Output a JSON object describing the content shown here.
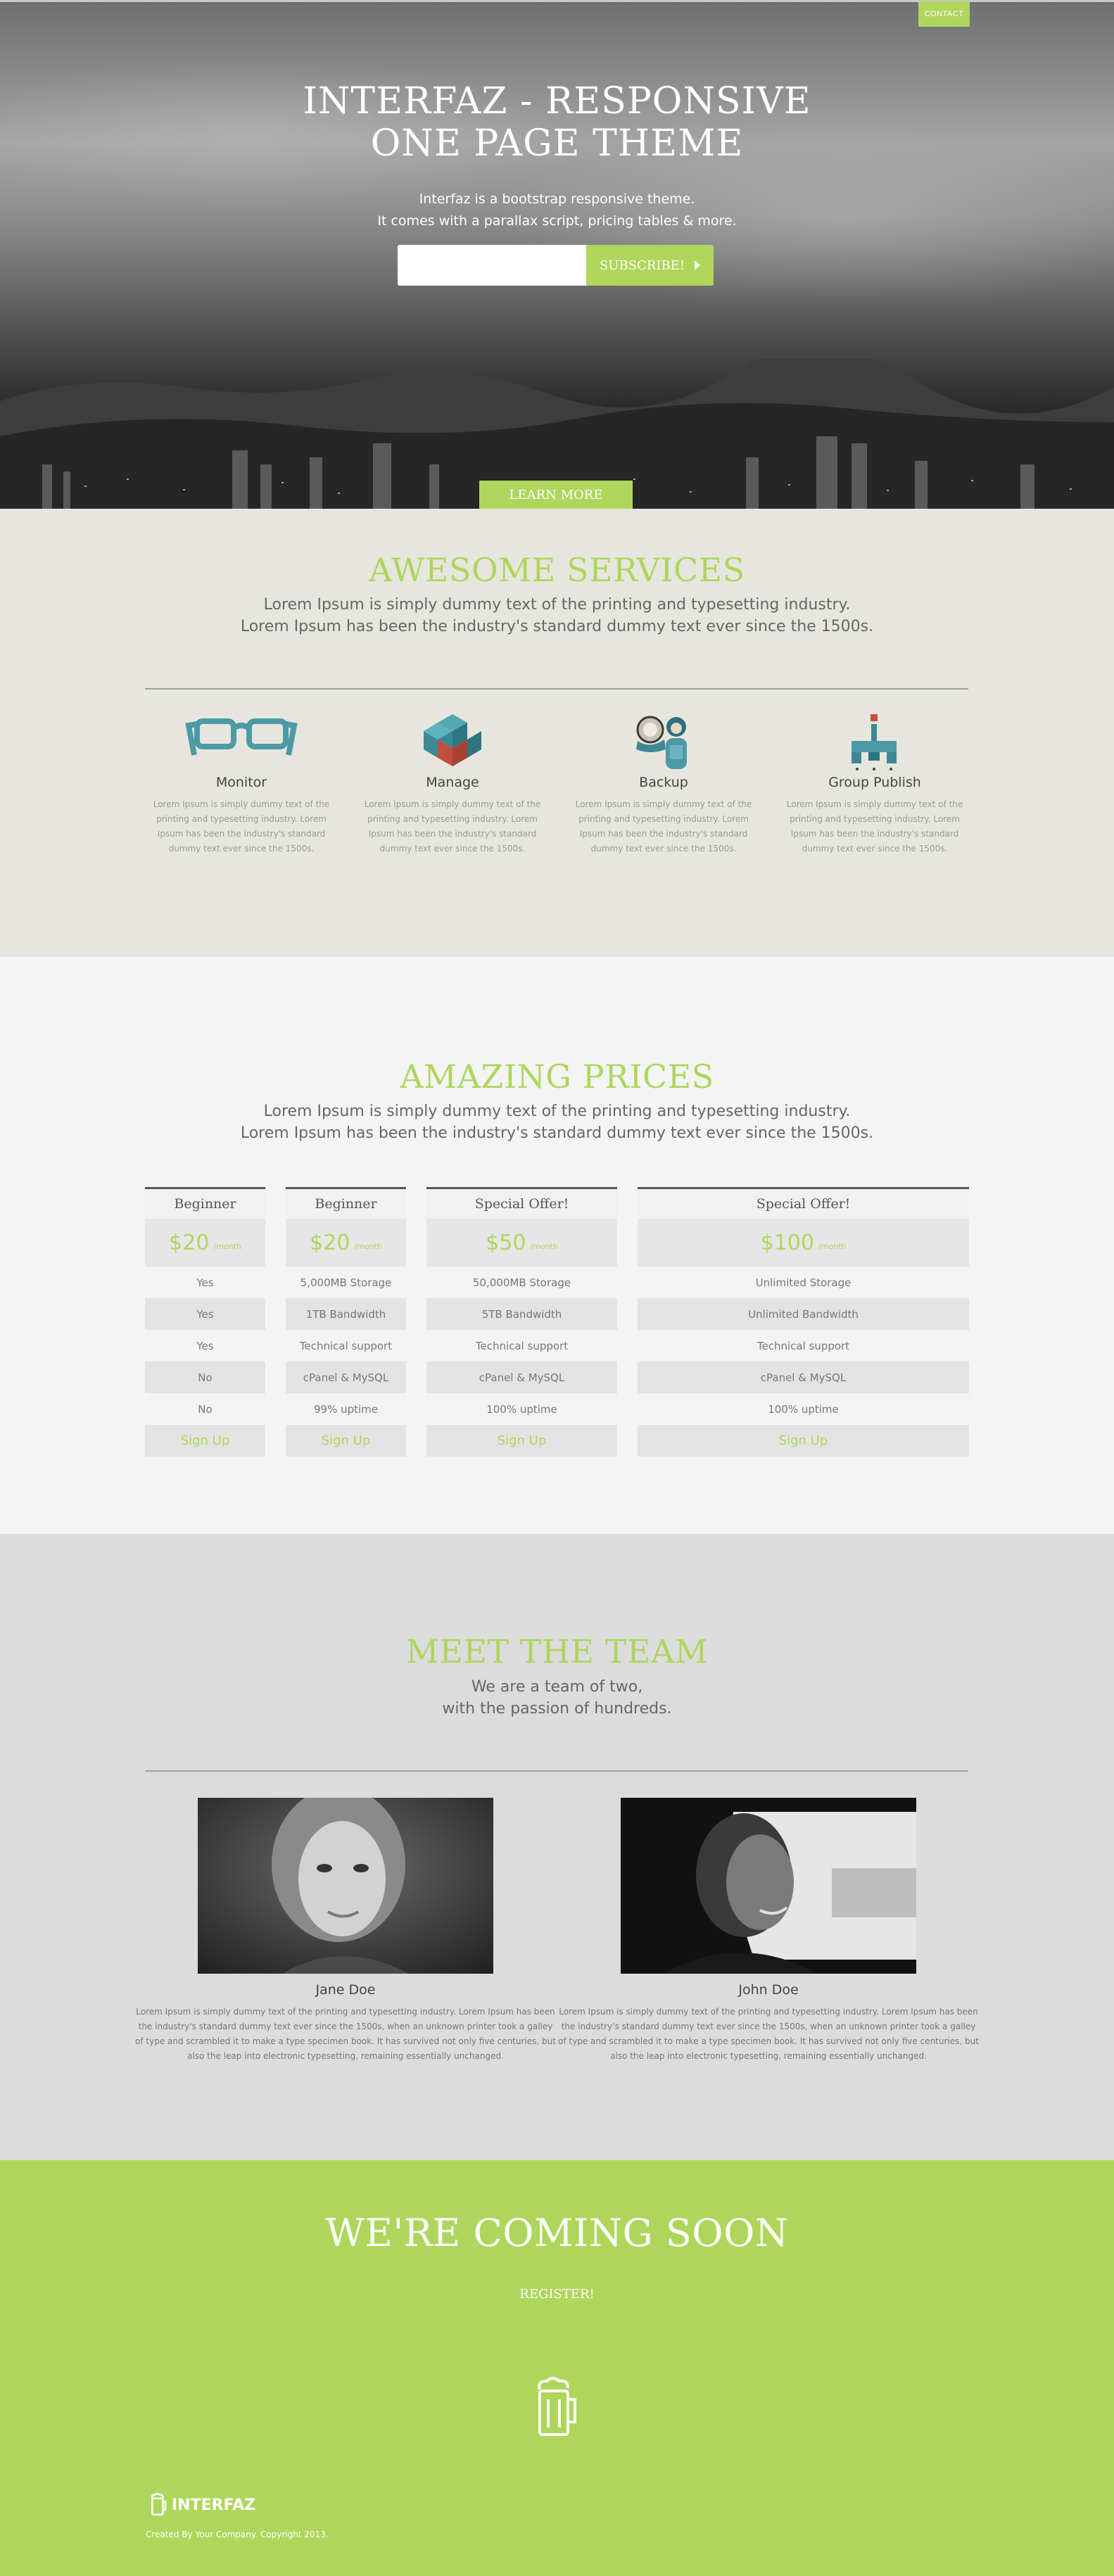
{
  "nav": {
    "contact_label": "CONTACT"
  },
  "hero": {
    "title_line1": "INTERFAZ - RESPONSIVE",
    "title_line2": "ONE PAGE THEME",
    "subtitle_line1": "Interfaz is a bootstrap responsive theme.",
    "subtitle_line2": "It comes with a parallax script, pricing tables & more.",
    "email_placeholder": "",
    "subscribe_label": "SUBSCRIBE!",
    "learn_more_label": "LEARN MORE"
  },
  "services": {
    "title": "AWESOME SERVICES",
    "subtitle_line1": "Lorem Ipsum is simply dummy text of the printing and typesetting industry.",
    "subtitle_line2": "Lorem Ipsum has been the industry's standard dummy text ever since the 1500s.",
    "items": [
      {
        "name": "Monitor",
        "icon": "glasses-icon",
        "desc": "Lorem Ipsum is simply dummy text of the printing and typesetting industry. Lorem Ipsum has been the industry's standard dummy text ever since the 1500s."
      },
      {
        "name": "Manage",
        "icon": "cubes-icon",
        "desc": "Lorem Ipsum is simply dummy text of the printing and typesetting industry. Lorem Ipsum has been the industry's standard dummy text ever since the 1500s."
      },
      {
        "name": "Backup",
        "icon": "people-icon",
        "desc": "Lorem Ipsum is simply dummy text of the printing and typesetting industry. Lorem Ipsum has been the industry's standard dummy text ever since the 1500s."
      },
      {
        "name": "Group Publish",
        "icon": "publish-icon",
        "desc": "Lorem Ipsum is simply dummy text of the printing and typesetting industry. Lorem Ipsum has been the industry's standard dummy text ever since the 1500s."
      }
    ]
  },
  "prices": {
    "title": "AMAZING PRICES",
    "subtitle_line1": "Lorem Ipsum is simply dummy text of the printing and typesetting industry.",
    "subtitle_line2": "Lorem Ipsum has been the industry's standard dummy text ever since the 1500s.",
    "per_label": "/month",
    "signup_label": "Sign Up",
    "plans": [
      {
        "name": "Beginner",
        "price": "$20",
        "features": [
          "Yes",
          "Yes",
          "Yes",
          "No",
          "No"
        ]
      },
      {
        "name": "Beginner",
        "price": "$20",
        "features": [
          "5,000MB Storage",
          "1TB Bandwidth",
          "Technical support",
          "cPanel & MySQL",
          "99% uptime"
        ]
      },
      {
        "name": "Special Offer!",
        "price": "$50",
        "features": [
          "50,000MB Storage",
          "5TB Bandwidth",
          "Technical support",
          "cPanel & MySQL",
          "100% uptime"
        ]
      },
      {
        "name": "Special Offer!",
        "price": "$100",
        "features": [
          "Unlimited Storage",
          "Unlimited Bandwidth",
          "Technical support",
          "cPanel & MySQL",
          "100% uptime"
        ]
      }
    ]
  },
  "team": {
    "title": "MEET THE TEAM",
    "subtitle_line1": "We are a team of two,",
    "subtitle_line2": "with the passion of hundreds.",
    "members": [
      {
        "name": "Jane Doe",
        "bio": "Lorem Ipsum is simply dummy text of the printing and typesetting industry. Lorem Ipsum has been the industry's standard dummy text ever since the 1500s, when an unknown printer took a galley of type and scrambled it to make a type specimen book. It has survived not only five centuries, but also the leap into electronic typesetting, remaining essentially unchanged."
      },
      {
        "name": "John Doe",
        "bio": "Lorem Ipsum is simply dummy text of the printing and typesetting industry. Lorem Ipsum has been the industry's standard dummy text ever since the 1500s, when an unknown printer took a galley of type and scrambled it to make a type specimen book. It has survived not only five centuries, but also the leap into electronic typesetting, remaining essentially unchanged."
      }
    ]
  },
  "footer": {
    "coming_soon": "WE'RE COMING SOON",
    "register_label": "REGISTER!",
    "logo_text": "INTERFAZ",
    "copyright": "Created By Your Company. Copyright 2013."
  },
  "colors": {
    "accent": "#aed65b",
    "services_bg": "#e6e6de",
    "prices_bg": "#f4f4f4",
    "team_bg": "#dcdcdd"
  }
}
